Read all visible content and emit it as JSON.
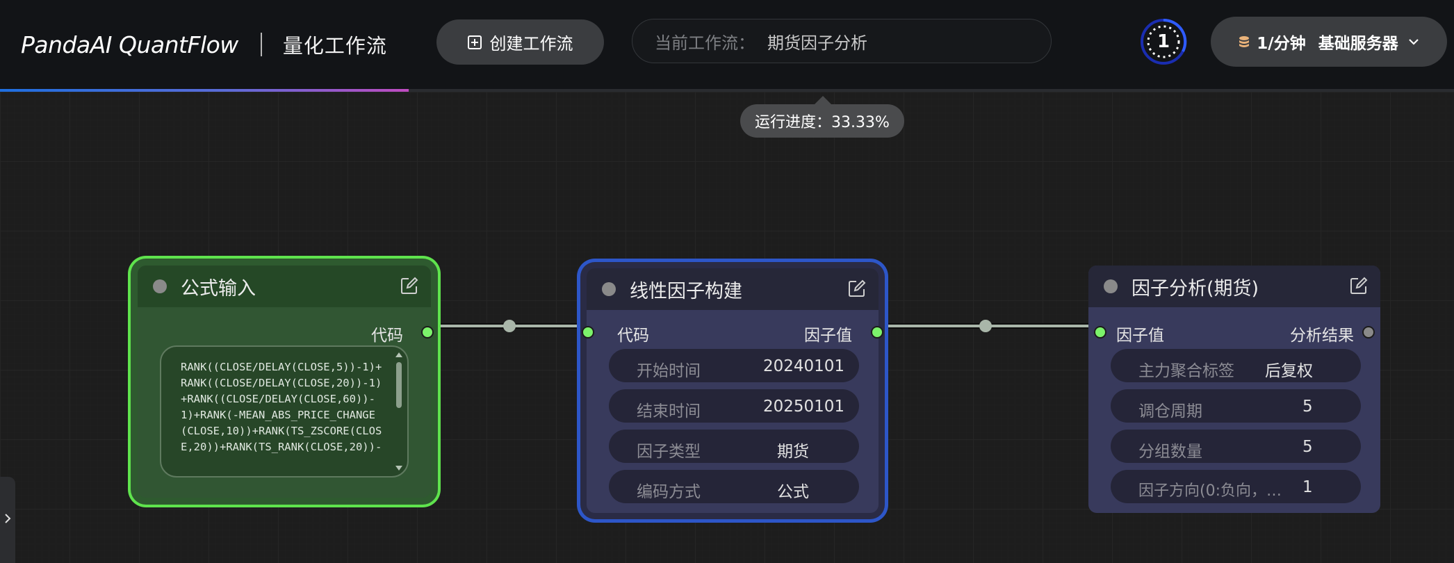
{
  "header": {
    "brand": "PandaAI QuantFlow",
    "subtitle": "量化工作流",
    "create_button": "创建工作流",
    "current_flow_label": "当前工作流：",
    "current_flow_name": "期货因子分析",
    "run_count": "1",
    "server": {
      "rate": "1/分钟",
      "name": "基础服务器"
    }
  },
  "progress": {
    "fraction": 0.3333,
    "tooltip": "运行进度：33.33%"
  },
  "nodes": {
    "formula": {
      "title": "公式输入",
      "output_port": "代码",
      "formula": "RANK((CLOSE/DELAY(CLOSE,5))-1)+RANK((CLOSE/DELAY(CLOSE,20))-1)+RANK((CLOSE/DELAY(CLOSE,60))-1)+RANK(-MEAN_ABS_PRICE_CHANGE(CLOSE,10))+RANK(TS_ZSCORE(CLOSE,20))+RANK(TS_RANK(CLOSE,20))-"
    },
    "linear": {
      "title": "线性因子构建",
      "input_port": "代码",
      "output_port": "因子值",
      "params": [
        {
          "key": "开始时间",
          "value": "20240101"
        },
        {
          "key": "结束时间",
          "value": "20250101"
        },
        {
          "key": "因子类型",
          "value": "期货"
        },
        {
          "key": "编码方式",
          "value": "公式"
        }
      ]
    },
    "analysis": {
      "title": "因子分析(期货)",
      "input_port": "因子值",
      "output_port": "分析结果",
      "params": [
        {
          "key": "主力聚合标签",
          "value": "后复权"
        },
        {
          "key": "调仓周期",
          "value": "5"
        },
        {
          "key": "分组数量",
          "value": "5"
        },
        {
          "key": "因子方向(0:负向，…",
          "value": "1"
        }
      ]
    }
  },
  "colors": {
    "accent_blue": "#2d56c8",
    "accent_green": "#5fe34d",
    "port_active": "#7cf36b",
    "port_idle": "#8a8a8a"
  },
  "icons": [
    "plus-square-icon",
    "coin-stack-icon",
    "chevron-down-icon",
    "edit-icon",
    "chevron-right-icon"
  ]
}
